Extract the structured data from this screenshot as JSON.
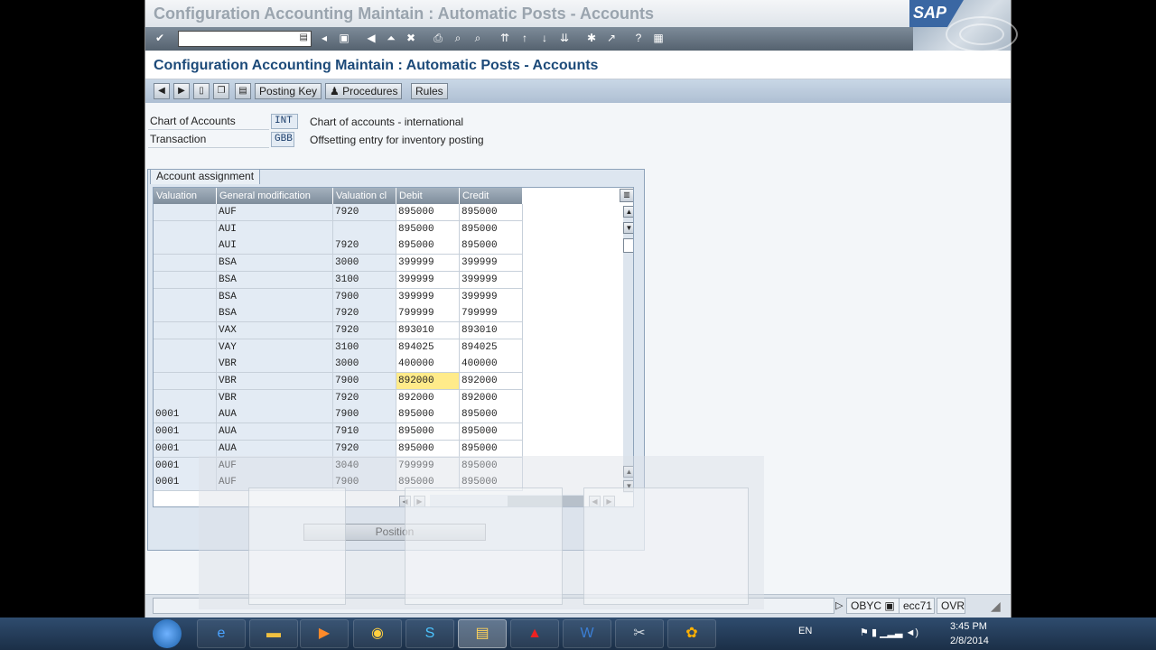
{
  "window": {
    "title": "Configuration Accounting Maintain : Automatic Posts - Accounts",
    "logo_text": "SAP"
  },
  "screen_title": "Configuration Accounting Maintain : Automatic Posts - Accounts",
  "app_toolbar": {
    "posting_key": "Posting Key",
    "procedures": "Procedures",
    "rules": "Rules"
  },
  "header_fields": {
    "chart_label": "Chart of Accounts",
    "chart_value": "INT",
    "chart_desc": "Chart of accounts - international",
    "transaction_label": "Transaction",
    "transaction_value": "GBB",
    "transaction_desc": "Offsetting entry for inventory posting"
  },
  "account_assignment": {
    "tab_label": "Account assignment",
    "columns": [
      "Valuation",
      "General modification",
      "Valuation cl",
      "Debit",
      "Credit"
    ],
    "rows": [
      [
        "",
        "AUF",
        "7920",
        "895000",
        "895000"
      ],
      [
        "",
        "AUI",
        "",
        "895000",
        "895000"
      ],
      [
        "",
        "AUI",
        "7920",
        "895000",
        "895000"
      ],
      [
        "",
        "BSA",
        "3000",
        "399999",
        "399999"
      ],
      [
        "",
        "BSA",
        "3100",
        "399999",
        "399999"
      ],
      [
        "",
        "BSA",
        "7900",
        "399999",
        "399999"
      ],
      [
        "",
        "BSA",
        "7920",
        "799999",
        "799999"
      ],
      [
        "",
        "VAX",
        "7920",
        "893010",
        "893010"
      ],
      [
        "",
        "VAY",
        "3100",
        "894025",
        "894025"
      ],
      [
        "",
        "VBR",
        "3000",
        "400000",
        "400000"
      ],
      [
        "",
        "VBR",
        "7900",
        "892000",
        "892000"
      ],
      [
        "",
        "VBR",
        "7920",
        "892000",
        "892000"
      ],
      [
        "0001",
        "AUA",
        "7900",
        "895000",
        "895000"
      ],
      [
        "0001",
        "AUA",
        "7910",
        "895000",
        "895000"
      ],
      [
        "0001",
        "AUA",
        "7920",
        "895000",
        "895000"
      ],
      [
        "0001",
        "AUF",
        "3040",
        "799999",
        "895000"
      ],
      [
        "0001",
        "AUF",
        "7900",
        "895000",
        "895000"
      ]
    ],
    "selected_row": 10,
    "position_button": "Position"
  },
  "status_bar": {
    "transaction": "OBYC",
    "server": "ecc71",
    "mode": "OVR"
  },
  "taskbar": {
    "language": "EN",
    "time": "3:45 PM",
    "date": "2/8/2014"
  }
}
